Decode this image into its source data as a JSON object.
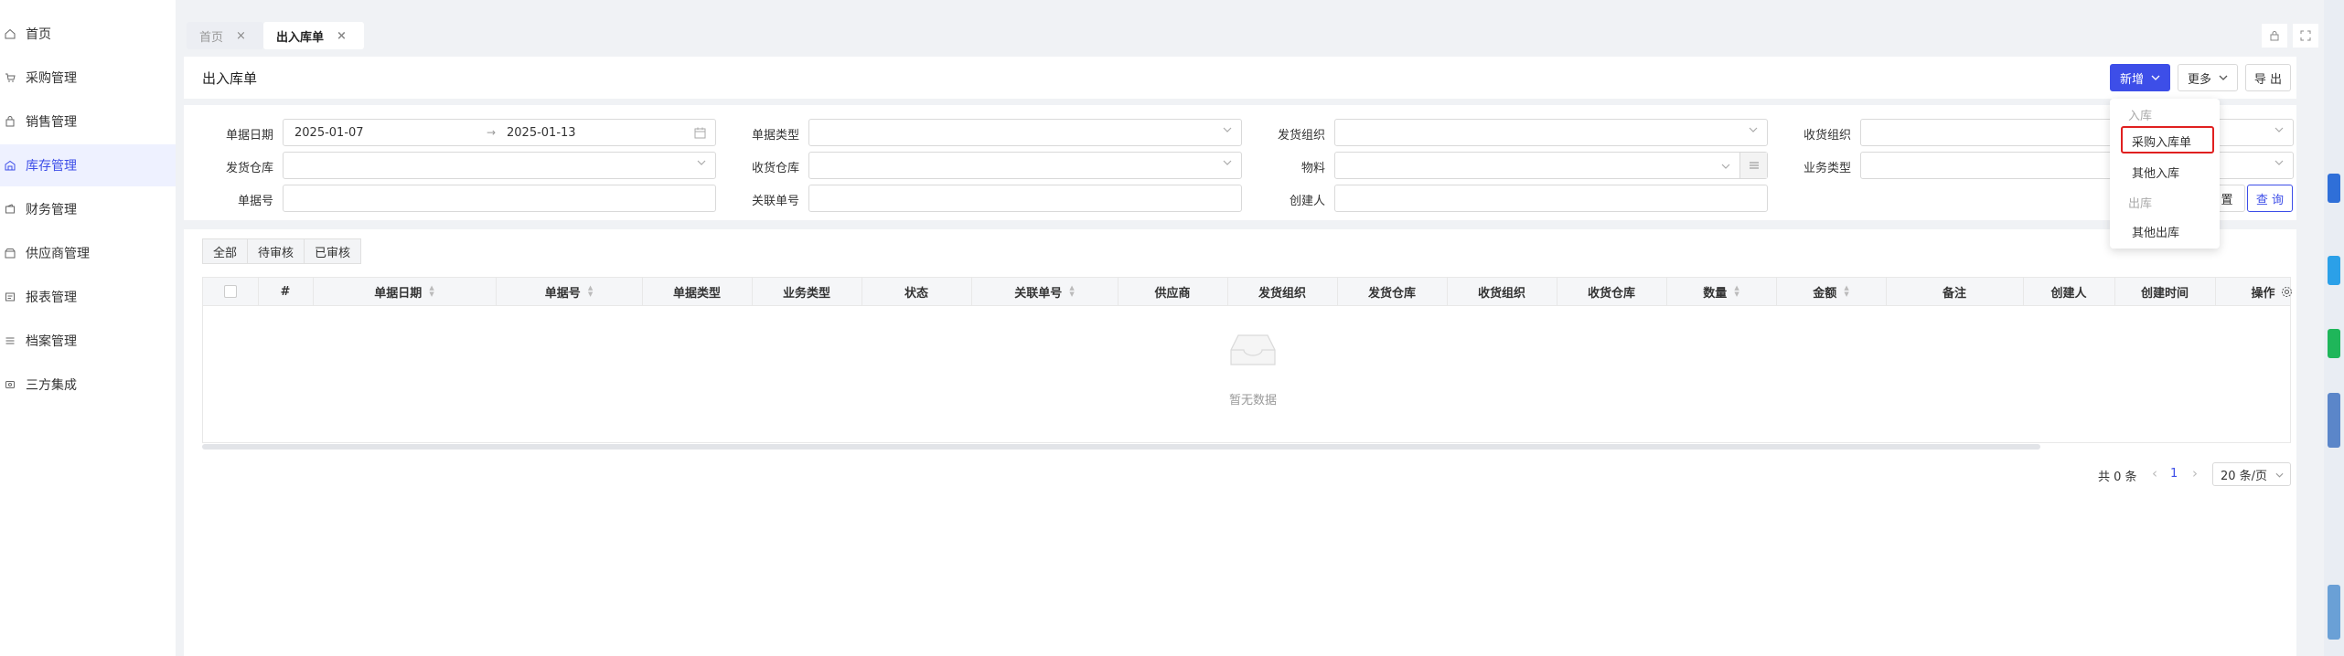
{
  "sidebar": {
    "items": [
      {
        "label": "首页",
        "icon": "home-icon"
      },
      {
        "label": "采购管理",
        "icon": "cart-icon"
      },
      {
        "label": "销售管理",
        "icon": "bag-icon"
      },
      {
        "label": "库存管理",
        "icon": "warehouse-icon"
      },
      {
        "label": "财务管理",
        "icon": "wallet-icon"
      },
      {
        "label": "供应商管理",
        "icon": "supplier-icon"
      },
      {
        "label": "报表管理",
        "icon": "report-icon"
      },
      {
        "label": "档案管理",
        "icon": "archive-icon"
      },
      {
        "label": "三方集成",
        "icon": "integration-icon"
      }
    ],
    "active_index": 3
  },
  "tabs": [
    {
      "label": "首页",
      "close": "×"
    },
    {
      "label": "出入库单",
      "close": "×"
    }
  ],
  "header": {
    "title": "出入库单",
    "new_label": "新增",
    "more_label": "更多",
    "export_label": "导 出"
  },
  "dropdown": {
    "group_in": "入库",
    "item_purchase_in": "采购入库单",
    "item_other_in": "其他入库",
    "group_out": "出库",
    "item_other_out": "其他出库"
  },
  "filters": {
    "date_label": "单据日期",
    "date_start": "2025-01-07",
    "date_sep": "→",
    "date_end": "2025-01-13",
    "doc_type_label": "单据类型",
    "ship_org_label": "发货组织",
    "recv_org_label": "收货组织",
    "ship_wh_label": "发货仓库",
    "recv_wh_label": "收货仓库",
    "material_label": "物料",
    "biz_type_label": "业务类型",
    "doc_no_label": "单据号",
    "rel_no_label": "关联单号",
    "creator_label": "创建人",
    "reset_label": "置",
    "query_label": "查 询"
  },
  "status_tabs": [
    "全部",
    "待审核",
    "已审核"
  ],
  "table": {
    "columns": [
      "#",
      "单据日期",
      "单据号",
      "单据类型",
      "业务类型",
      "状态",
      "关联单号",
      "供应商",
      "发货组织",
      "发货仓库",
      "收货组织",
      "收货仓库",
      "数量",
      "金额",
      "备注",
      "创建人",
      "创建时间",
      "操作"
    ],
    "empty_text": "暂无数据"
  },
  "pagination": {
    "total": "共 0 条",
    "prev": "‹",
    "page": "1",
    "next": "›",
    "page_size": "20 条/页"
  },
  "colors": {
    "accent": "#3d4ee8",
    "highlight_border": "#e02020"
  }
}
